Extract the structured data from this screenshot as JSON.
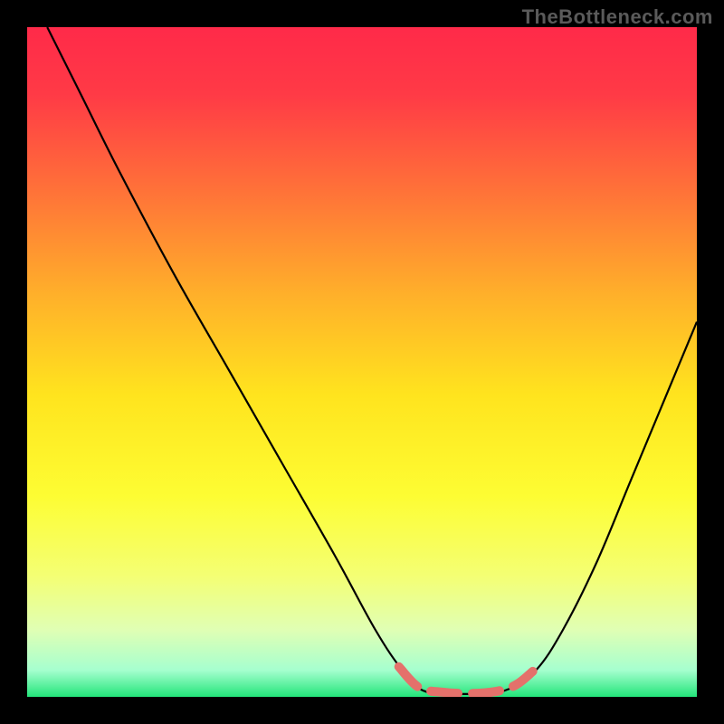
{
  "watermark": "TheBottleneck.com",
  "chart_data": {
    "type": "line",
    "title": "",
    "xlabel": "",
    "ylabel": "",
    "xlim": [
      0,
      100
    ],
    "ylim": [
      0,
      100
    ],
    "background_gradient": {
      "stops": [
        {
          "offset": 0.0,
          "color": "#ff2a49"
        },
        {
          "offset": 0.1,
          "color": "#ff3a46"
        },
        {
          "offset": 0.25,
          "color": "#ff7438"
        },
        {
          "offset": 0.4,
          "color": "#ffb02a"
        },
        {
          "offset": 0.55,
          "color": "#ffe41e"
        },
        {
          "offset": 0.7,
          "color": "#fdfd33"
        },
        {
          "offset": 0.82,
          "color": "#f4ff74"
        },
        {
          "offset": 0.9,
          "color": "#e0ffb4"
        },
        {
          "offset": 0.96,
          "color": "#a6ffcf"
        },
        {
          "offset": 1.0,
          "color": "#23e57a"
        }
      ]
    },
    "series": [
      {
        "name": "bottleneck-curve",
        "stroke": "#000000",
        "stroke_width": 2.2,
        "points": [
          {
            "x": 3.0,
            "y": 100.0
          },
          {
            "x": 8.0,
            "y": 90.0
          },
          {
            "x": 14.0,
            "y": 78.0
          },
          {
            "x": 22.0,
            "y": 63.0
          },
          {
            "x": 30.0,
            "y": 49.0
          },
          {
            "x": 38.0,
            "y": 35.0
          },
          {
            "x": 46.0,
            "y": 21.0
          },
          {
            "x": 52.0,
            "y": 10.0
          },
          {
            "x": 56.0,
            "y": 4.0
          },
          {
            "x": 59.0,
            "y": 1.0
          },
          {
            "x": 63.0,
            "y": 0.5
          },
          {
            "x": 68.0,
            "y": 0.5
          },
          {
            "x": 72.0,
            "y": 1.2
          },
          {
            "x": 76.0,
            "y": 4.0
          },
          {
            "x": 80.0,
            "y": 10.0
          },
          {
            "x": 85.0,
            "y": 20.0
          },
          {
            "x": 90.0,
            "y": 32.0
          },
          {
            "x": 95.0,
            "y": 44.0
          },
          {
            "x": 100.0,
            "y": 56.0
          }
        ]
      },
      {
        "name": "highlighted-valley",
        "stroke": "#e4716b",
        "stroke_width": 10,
        "linecap": "round",
        "dash": [
          30,
          16
        ],
        "points": [
          {
            "x": 55.5,
            "y": 4.5
          },
          {
            "x": 58.5,
            "y": 1.4
          },
          {
            "x": 62.0,
            "y": 0.7
          },
          {
            "x": 66.0,
            "y": 0.5
          },
          {
            "x": 70.0,
            "y": 0.8
          },
          {
            "x": 73.0,
            "y": 1.8
          },
          {
            "x": 75.5,
            "y": 3.8
          }
        ]
      }
    ]
  }
}
